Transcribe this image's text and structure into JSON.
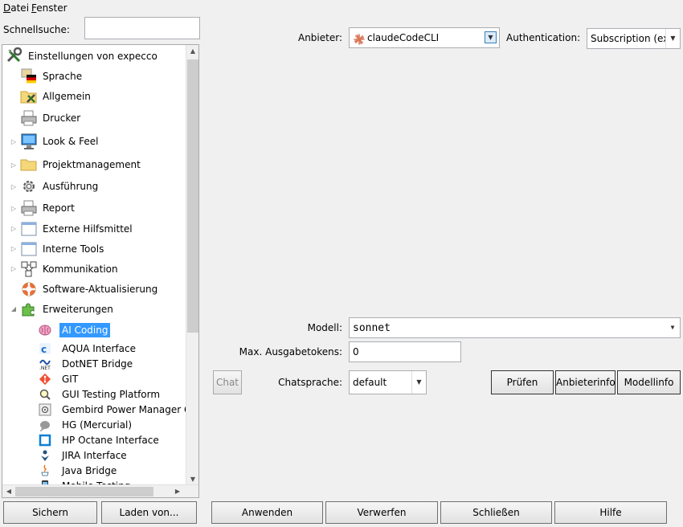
{
  "menu": {
    "file_underline": "D",
    "file_rest": "atei",
    "window_underline": "F",
    "window_rest": "enster"
  },
  "search": {
    "label": "Schnellsuche:",
    "value": ""
  },
  "tree": {
    "root": {
      "label": "Einstellungen von expecco",
      "icon": "wrench-screwdriver-icon"
    },
    "items": [
      {
        "label": "Sprache",
        "icon": "german-flag-icon",
        "expandable": false
      },
      {
        "label": "Allgemein",
        "icon": "folder-tools-icon",
        "expandable": false
      },
      {
        "label": "Drucker",
        "icon": "printer-icon",
        "expandable": false
      },
      {
        "label": "Look & Feel",
        "icon": "monitor-icon",
        "expandable": true
      },
      {
        "label": "Projektmanagement",
        "icon": "folder-icon",
        "expandable": true
      },
      {
        "label": "Ausführung",
        "icon": "gear-icon",
        "expandable": true
      },
      {
        "label": "Report",
        "icon": "printer-report-icon",
        "expandable": true
      },
      {
        "label": "Externe Hilfsmittel",
        "icon": "window-icon",
        "expandable": true
      },
      {
        "label": "Interne Tools",
        "icon": "window-icon",
        "expandable": true
      },
      {
        "label": "Kommunikation",
        "icon": "network-cubes-icon",
        "expandable": true
      },
      {
        "label": "Software-Aktualisierung",
        "icon": "lifebuoy-icon",
        "expandable": false
      },
      {
        "label": "Erweiterungen",
        "icon": "puzzle-icon",
        "expandable": true,
        "expanded": true
      }
    ],
    "sub_items": [
      {
        "label": "AI Coding",
        "icon": "brain-icon",
        "selected": true
      },
      {
        "label": "AQUA Interface",
        "icon": "aqua-icon"
      },
      {
        "label": "DotNET Bridge",
        "icon": "dotnet-icon"
      },
      {
        "label": "GIT",
        "icon": "git-icon"
      },
      {
        "label": "GUI Testing Platform",
        "icon": "magnifier-icon"
      },
      {
        "label": "Gembird Power Manager Con",
        "icon": "power-icon"
      },
      {
        "label": "HG (Mercurial)",
        "icon": "mercurial-icon"
      },
      {
        "label": "HP Octane Interface",
        "icon": "octane-icon"
      },
      {
        "label": "JIRA Interface",
        "icon": "jira-icon"
      },
      {
        "label": "Java Bridge",
        "icon": "java-icon"
      },
      {
        "label": "Mobile Testing",
        "icon": "mobile-icon"
      }
    ]
  },
  "left_buttons": {
    "save": "Sichern",
    "load": "Laden von..."
  },
  "provider": {
    "label": "Anbieter:",
    "value": "claudeCodeCLI",
    "icon": "claude-sunburst-icon",
    "icon_color": "#d97757"
  },
  "auth": {
    "label": "Authentication:",
    "value": "Subscription (ext"
  },
  "model": {
    "label": "Modell:",
    "value": "sonnet"
  },
  "max_tokens": {
    "label": "Max. Ausgabetokens:",
    "value": "0"
  },
  "chat": {
    "button": "Chat",
    "lang_label": "Chatsprache:",
    "lang_value": "default"
  },
  "actions": {
    "check": "Prüfen",
    "provider_info": "Anbieterinfo",
    "model_info": "Modellinfo"
  },
  "bottom_buttons": {
    "apply": "Anwenden",
    "discard": "Verwerfen",
    "close": "Schließen",
    "help": "Hilfe"
  },
  "colors": {
    "selection": "#3399ff",
    "background": "#f0f0f0"
  }
}
